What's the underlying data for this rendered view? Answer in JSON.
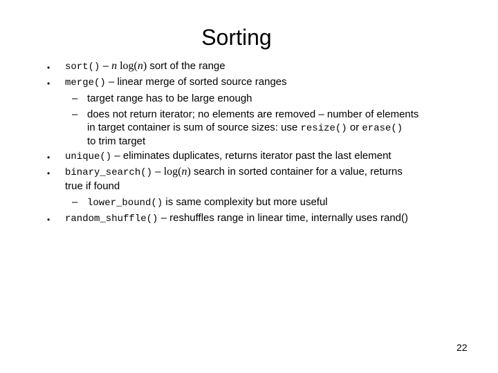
{
  "slide": {
    "title": "Sorting",
    "page_number": "22",
    "bullet_glyph": "•",
    "dash_glyph": "–",
    "items": [
      {
        "code": "sort()",
        "sep": " – ",
        "math_pre": "n",
        "math_fn": " log(",
        "math_arg": "n",
        "math_close": ")",
        "text": " sort of the range"
      },
      {
        "code": "merge()",
        "sep": " – ",
        "text": "linear merge of sorted source ranges",
        "subitems": [
          {
            "text": "target range has to be large enough"
          },
          {
            "text_line1": "does not return iterator; no elements are removed – number of elements",
            "text_line2_pre": "in target container is sum of source sizes: use ",
            "code1": "resize()",
            "mid": " or ",
            "code2": "erase()",
            "text_line3": "to trim target"
          }
        ]
      },
      {
        "code": "unique()",
        "sep": " – ",
        "text": "eliminates duplicates, returns iterator past the last element"
      },
      {
        "code": "binary_search()",
        "sep": " – ",
        "math_fn": "log(",
        "math_arg": "n",
        "math_close": ")",
        "text": " search in sorted container for a value, returns",
        "text_line2": "true if found",
        "subitems": [
          {
            "code": "lower_bound()",
            "text": " is same complexity but more useful"
          }
        ]
      },
      {
        "code": "random_shuffle()",
        "sep": " – ",
        "text": "reshuffles range in linear time, internally uses rand()"
      }
    ]
  }
}
